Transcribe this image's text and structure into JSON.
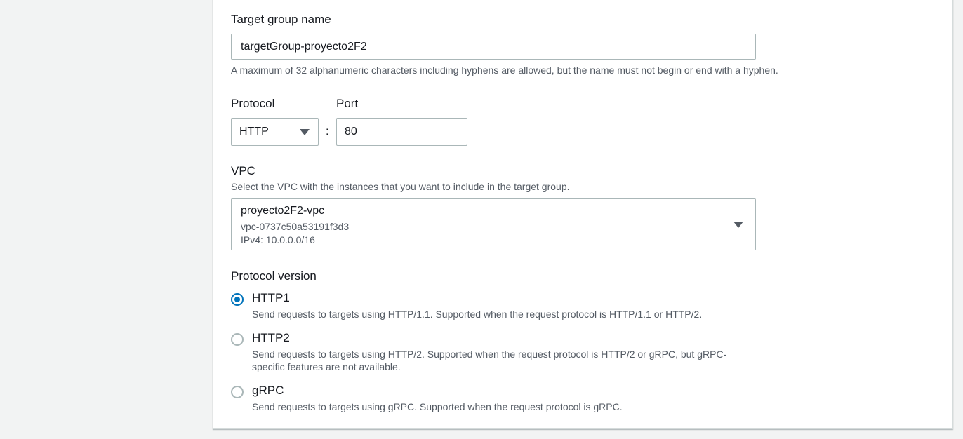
{
  "target_group": {
    "label": "Target group name",
    "value": "targetGroup-proyecto2F2",
    "hint": "A maximum of 32 alphanumeric characters including hyphens are allowed, but the name must not begin or end with a hyphen."
  },
  "protocol": {
    "label": "Protocol",
    "selected": "HTTP"
  },
  "separator": ":",
  "port": {
    "label": "Port",
    "value": "80"
  },
  "vpc": {
    "label": "VPC",
    "hint": "Select the VPC with the instances that you want to include in the target group.",
    "selected_name": "proyecto2F2-vpc",
    "selected_id": "vpc-0737c50a53191f3d3",
    "selected_cidr": "IPv4: 10.0.0.0/16"
  },
  "protocol_version": {
    "label": "Protocol version",
    "selected": "HTTP1",
    "options": [
      {
        "title": "HTTP1",
        "description": "Send requests to targets using HTTP/1.1. Supported when the request protocol is HTTP/1.1 or HTTP/2."
      },
      {
        "title": "HTTP2",
        "description": "Send requests to targets using HTTP/2. Supported when the request protocol is HTTP/2 or gRPC, but gRPC-specific features are not available."
      },
      {
        "title": "gRPC",
        "description": "Send requests to targets using gRPC. Supported when the request protocol is gRPC."
      }
    ]
  },
  "colors": {
    "accent": "#0073bb",
    "border": "#aab7b8",
    "text": "#16191f",
    "muted": "#545b64"
  },
  "icons": {
    "dropdown": "caret-down-icon",
    "radio": "radio-button"
  }
}
